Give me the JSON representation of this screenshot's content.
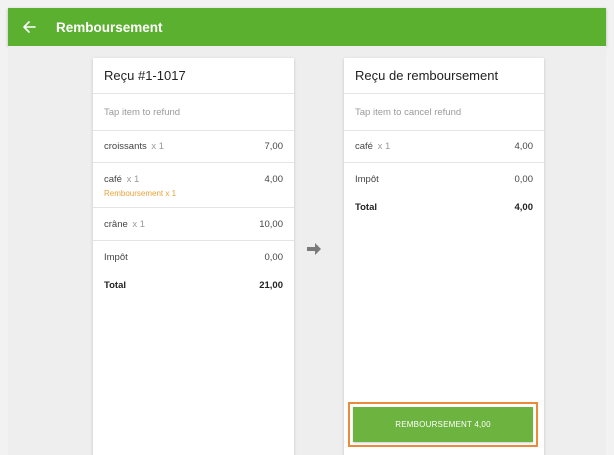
{
  "appbar": {
    "title": "Remboursement",
    "back_icon": "arrow-left-icon",
    "color": "#5cb030"
  },
  "receipt": {
    "title": "Reçu #1-1017",
    "hint": "Tap item to refund",
    "items": [
      {
        "name": "croissants",
        "qty": "x 1",
        "price": "7,00",
        "refund": ""
      },
      {
        "name": "café",
        "qty": "x 1",
        "price": "4,00",
        "refund": "Remboursement x 1"
      },
      {
        "name": "crâne",
        "qty": "x 1",
        "price": "10,00",
        "refund": ""
      }
    ],
    "tax_label": "Impôt",
    "tax_value": "0,00",
    "total_label": "Total",
    "total_value": "21,00"
  },
  "refund_receipt": {
    "title": "Reçu de remboursement",
    "hint": "Tap item to cancel refund",
    "items": [
      {
        "name": "café",
        "qty": "x 1",
        "price": "4,00"
      }
    ],
    "tax_label": "Impôt",
    "tax_value": "0,00",
    "total_label": "Total",
    "total_value": "4,00"
  },
  "transfer_icon": "arrow-right-icon",
  "refund_button": {
    "label": "REMBOURSEMENT 4,00",
    "color": "#6cb33f",
    "highlight_color": "#e98a3c"
  }
}
